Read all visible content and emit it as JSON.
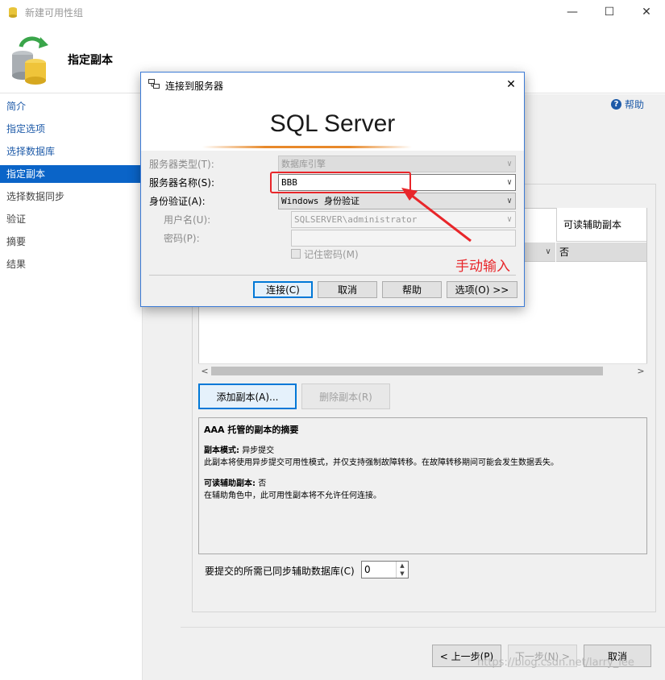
{
  "window": {
    "title": "新建可用性组",
    "minimize": "—",
    "maximize": "☐",
    "close": "✕"
  },
  "header": {
    "page_title": "指定副本"
  },
  "nav": {
    "items": [
      {
        "label": "简介"
      },
      {
        "label": "指定选项"
      },
      {
        "label": "选择数据库"
      },
      {
        "label": "指定副本"
      },
      {
        "label": "选择数据同步"
      },
      {
        "label": "验证"
      },
      {
        "label": "摘要"
      },
      {
        "label": "结果"
      }
    ]
  },
  "help": {
    "label": "帮助"
  },
  "grid": {
    "col_readable": "可读辅助副本",
    "cell_readable": "否"
  },
  "buttons": {
    "add_replica": "添加副本(A)...",
    "remove_replica": "删除副本(R)",
    "prev": "< 上一步(P)",
    "next": "下一步(N) >",
    "cancel": "取消"
  },
  "summary": {
    "title": "AAA 托管的副本的摘要",
    "mode_label": "副本模式:",
    "mode_value": "异步提交",
    "mode_desc": "此副本将使用异步提交可用性模式，并仅支持强制故障转移。在故障转移期间可能会发生数据丢失。",
    "readable_label": "可读辅助副本:",
    "readable_value": "否",
    "readable_desc": "在辅助角色中，此可用性副本将不允许任何连接。"
  },
  "sync_setting": {
    "label": "要提交的所需已同步辅助数据库(C)",
    "value": "0"
  },
  "watermark": "https://blog.csdn.net/larry_lee",
  "dialog": {
    "title": "连接到服务器",
    "product": "SQL Server",
    "server_type_label": "服务器类型(T):",
    "server_type_value": "数据库引擎",
    "server_name_label": "服务器名称(S):",
    "server_name_value": "BBB",
    "auth_label": "身份验证(A):",
    "auth_value": "Windows 身份验证",
    "username_label": "用户名(U):",
    "username_value": "SQLSERVER\\administrator",
    "password_label": "密码(P):",
    "remember_label": "记住密码(M)",
    "connect": "连接(C)",
    "cancel": "取消",
    "help": "帮助",
    "options": "选项(O) >>"
  },
  "annotation": {
    "text": "手动输入",
    "color": "#e8262a"
  },
  "colors": {
    "accent": "#0a64c8",
    "link": "#1d5aa8",
    "annotation": "#e8262a"
  },
  "icons": [
    "app-icon",
    "database-sync-icon",
    "help-icon",
    "server-connect-icon",
    "chevron-down-icon"
  ]
}
